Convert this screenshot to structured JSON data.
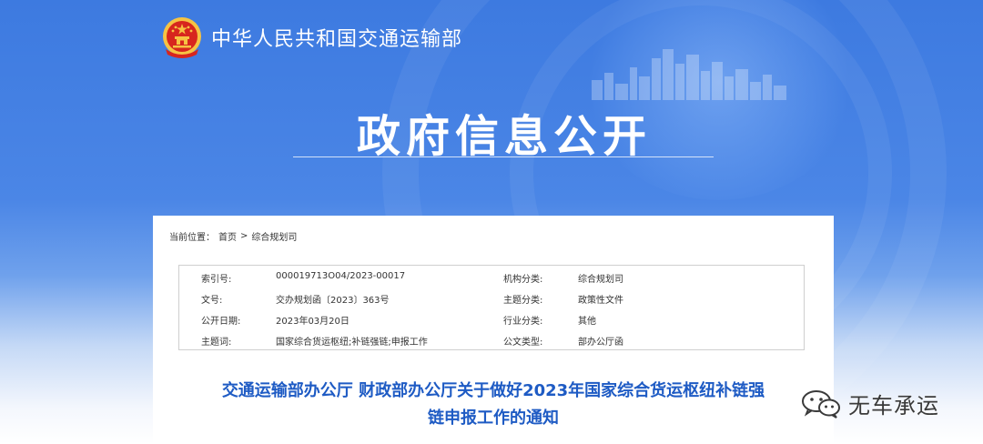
{
  "header": {
    "ministry_name": "中华人民共和国交通运输部"
  },
  "banner": {
    "title": "政府信息公开"
  },
  "breadcrumb": {
    "label": "当前位置：",
    "home": "首页",
    "separator": ">",
    "current": "综合规划司"
  },
  "info_table": {
    "rows": [
      {
        "label1": "索引号:",
        "value1": "000019713O04/2023-00017",
        "label2": "机构分类:",
        "value2": "综合规划司"
      },
      {
        "label1": "文号:",
        "value1": "交办规划函〔2023〕363号",
        "label2": "主题分类:",
        "value2": "政策性文件"
      },
      {
        "label1": "公开日期:",
        "value1": "2023年03月20日",
        "label2": "行业分类:",
        "value2": "其他"
      },
      {
        "label1": "主题词:",
        "value1": "国家综合货运枢纽;补链强链;申报工作",
        "label2": "公文类型:",
        "value2": "部办公厅函"
      }
    ]
  },
  "document": {
    "title_line1": "交通运输部办公厅 财政部办公厅关于做好2023年国家综合货运枢纽补链强",
    "title_line2": "链申报工作的通知"
  },
  "watermark": {
    "text": "无车承运"
  },
  "colors": {
    "banner_blue": "#3d7ae0",
    "title_blue": "#1e5bc4",
    "emblem_red": "#d7261e",
    "emblem_gold": "#f6c343"
  }
}
